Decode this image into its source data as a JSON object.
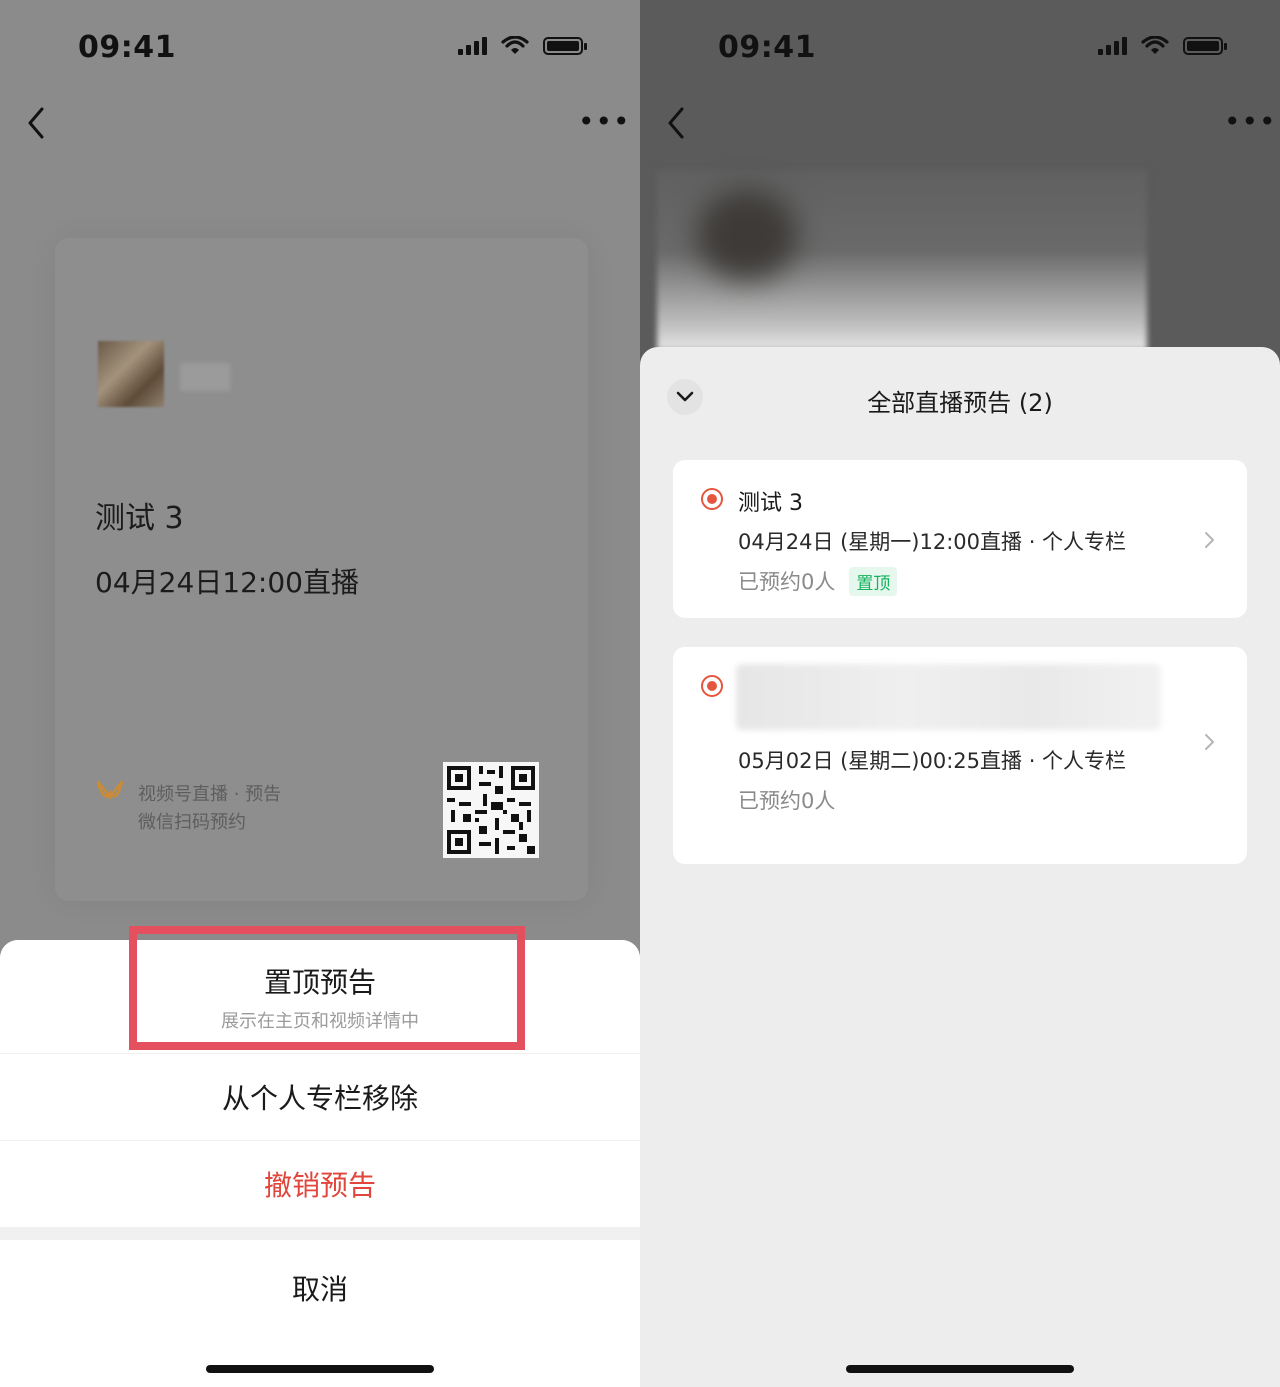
{
  "left_screen": {
    "status_bar": {
      "time": "09:41"
    },
    "poster": {
      "title": "测试 3",
      "datetime": "04月24日12:00直播",
      "brand_line1": "视频号直播 · 预告",
      "brand_line2": "微信扫码预约"
    },
    "action_sheet": {
      "pin": {
        "label": "置顶预告",
        "sublabel": "展示在主页和视频详情中"
      },
      "remove": {
        "label": "从个人专栏移除"
      },
      "revoke": {
        "label": "撤销预告"
      },
      "cancel": {
        "label": "取消"
      }
    },
    "colors": {
      "highlight_border": "#e5505e",
      "danger_text": "#e0463c"
    }
  },
  "right_screen": {
    "status_bar": {
      "time": "09:41"
    },
    "drawer": {
      "title": "全部直播预告 (2)",
      "items": [
        {
          "title": "测试 3",
          "schedule": "04月24日 (星期一)12:00直播 · 个人专栏",
          "reservations": "已预约0人",
          "badge": "置顶"
        },
        {
          "title": "",
          "schedule": "05月02日 (星期二)00:25直播 · 个人专栏",
          "reservations": "已预约0人"
        }
      ]
    },
    "colors": {
      "live_dot": "#e4563e",
      "pin_badge_text": "#16b35e"
    }
  }
}
